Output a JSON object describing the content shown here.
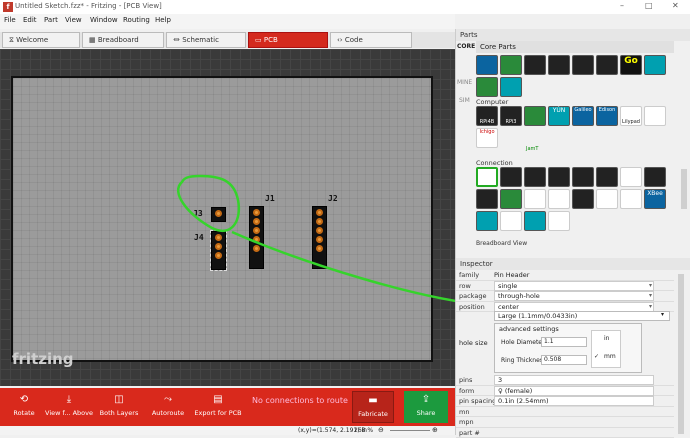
{
  "window": {
    "title": "Untitled Sketch.fzz* - Fritzing - [PCB View]",
    "app_icon": "f",
    "minimize": "–",
    "maximize": "□",
    "close": "✕"
  },
  "menu": [
    "File",
    "Edit",
    "Part",
    "View",
    "Window",
    "Routing",
    "Help"
  ],
  "tabs": [
    {
      "label": "Welcome",
      "icon": "⧖"
    },
    {
      "label": "Breadboard",
      "icon": "▦"
    },
    {
      "label": "Schematic",
      "icon": "⏛"
    },
    {
      "label": "PCB",
      "icon": "▭"
    },
    {
      "label": "Code",
      "icon": "‹›"
    }
  ],
  "canvas": {
    "brand": "fritzing",
    "labels": {
      "j1": "J1",
      "j2": "J2",
      "j3": "J3",
      "j4": "J4"
    }
  },
  "toolbar": {
    "rotate": "Rotate",
    "view": "View f... Above",
    "both_layers": "Both Layers",
    "autoroute": "Autoroute",
    "export": "Export for PCB",
    "routing_status": "No connections to route",
    "fabricate": "Fabricate",
    "share": "Share"
  },
  "status": {
    "coords": "(x,y)=(1.574, 2.191) in",
    "zoom": "268 %"
  },
  "parts": {
    "title": "Parts",
    "bin": "Core Parts",
    "sections": {
      "core": "CORE",
      "mine": "MINE",
      "sim": "SIM",
      "computer": "Computer",
      "connection": "Connection",
      "breadboard_view": "Breadboard View"
    },
    "computer_labels": [
      "RPi4B",
      "RPi3",
      "YÚN",
      "Galileo",
      "Edison",
      "Lilypad"
    ],
    "connection_labels": [
      "Ichigo",
      "JamT",
      "XBee"
    ]
  },
  "inspector": {
    "title": "Inspector",
    "family_label": "family",
    "family": "Pin Header",
    "rows": [
      {
        "k": "row",
        "v": "single"
      },
      {
        "k": "package",
        "v": "through-hole"
      },
      {
        "k": "position",
        "v": "center"
      }
    ],
    "hole_size_label": "hole size",
    "hole_size": "Large (1.1mm/0.0433in)",
    "advanced": "advanced settings",
    "hole_diameter_label": "Hole Diameter",
    "hole_diameter": "1.1",
    "ring_label": "Ring Thickness",
    "ring": "0.508",
    "unit_in": "in",
    "unit_mm": "mm",
    "rows2": [
      {
        "k": "pins",
        "v": "3"
      },
      {
        "k": "form",
        "v": "♀ (female)"
      },
      {
        "k": "pin spacing",
        "v": "0.1in (2.54mm)"
      },
      {
        "k": "mn",
        "v": ""
      },
      {
        "k": "mpn",
        "v": ""
      },
      {
        "k": "part #",
        "v": ""
      }
    ]
  }
}
